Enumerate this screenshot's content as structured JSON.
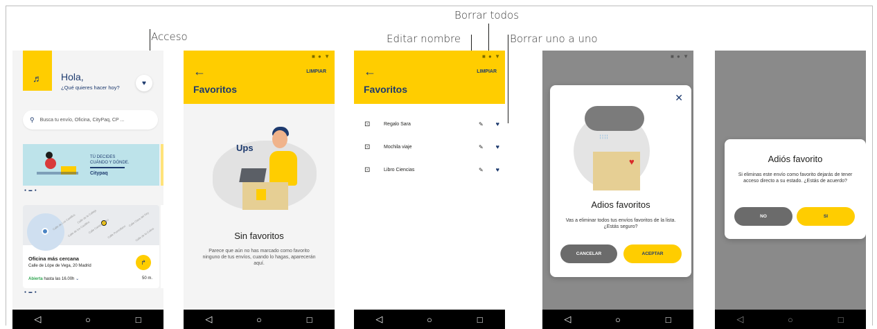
{
  "annotations": {
    "acceso": "Acceso",
    "borrar_todos": "Borrar todos",
    "editar_nombre": "Editar nombre",
    "borrar_uno": "Borrar uno a uno"
  },
  "screen1": {
    "greeting": "Hola,",
    "subtitle": "¿Qué quieres hacer hoy?",
    "search_placeholder": "Busca tu envío, Oficina, CityPaq, CP ...",
    "banner_line1": "TÚ DECIDES",
    "banner_line2": "CUÁNDO Y DÓNDE.",
    "banner_brand": "Citypaq",
    "streets": [
      "Calle de Los Castillos",
      "Calle de la Calleja",
      "Calle Camporamiro",
      "Calle de los Castillos",
      "Calle Puertollano",
      "Calle Clara del Rey",
      "Calle de la Colina"
    ],
    "office_title": "Oficina más cercana",
    "office_address": "Calle de Lópe de Vega, 20 Madrid",
    "office_open": "Abierta",
    "office_hours": "hasta las 16.00h",
    "distance": "50 m."
  },
  "screen2": {
    "title": "Favoritos",
    "clear": "LIMPIAR",
    "ups": "Ups",
    "empty_title": "Sin favoritos",
    "empty_desc": "Parece que aún no has marcado como favorito ninguno de tus envíos, cuando lo hagas, aparecerán aquí."
  },
  "screen3": {
    "title": "Favoritos",
    "clear": "LIMPIAR",
    "items": [
      "Regalo Sara",
      "Mochila viaje",
      "Libro Ciencias"
    ]
  },
  "screen4": {
    "title": "Adios favoritos",
    "desc": "Vas a eliminar todos tus envíos favoritos de la lista. ¿Estás seguro?",
    "cancel": "CANCELAR",
    "accept": "ACEPTAR"
  },
  "screen5": {
    "title": "Adiós favorito",
    "desc": "Si eliminas este envío como favorito dejarás de tener acceso directo a su estado. ¿Estás de acuerdo?",
    "no": "NO",
    "yes": "SI"
  },
  "icons": {
    "back": "back-arrow-icon",
    "heart": "heart-icon",
    "pencil": "pencil-icon",
    "package": "package-icon",
    "close": "close-icon",
    "search": "search-icon",
    "directions": "directions-icon"
  },
  "colors": {
    "brand_yellow": "#ffcd00",
    "brand_navy": "#1d3a6e",
    "overlay_gray": "#8a8a8a"
  }
}
